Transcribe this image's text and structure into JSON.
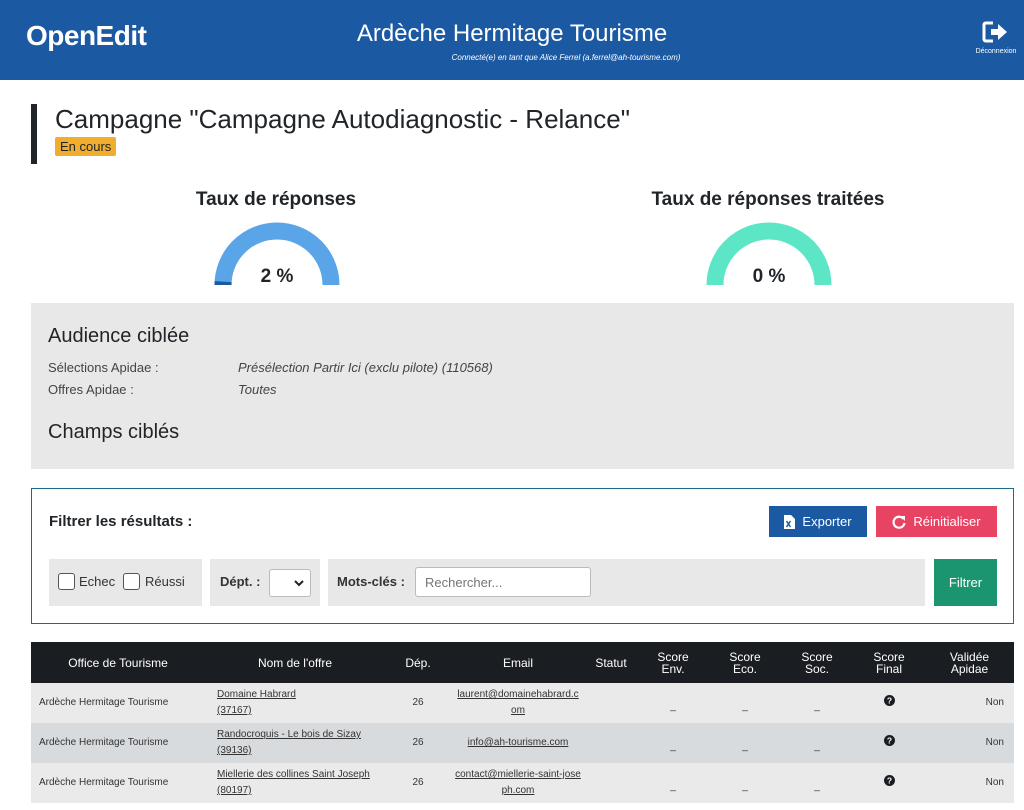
{
  "header": {
    "logo": "OpenEdit",
    "org_name": "Ardèche Hermitage Tourisme",
    "connected_as": "Connecté(e) en tant que Alice Ferrel (a.ferrel@ah-tourisme.com)",
    "logout_label": "Déconnexion"
  },
  "campaign": {
    "title": "Campagne \"Campagne Autodiagnostic - Relance\"",
    "status": "En cours",
    "status_color": "#f0ad2e"
  },
  "gauges": [
    {
      "title": "Taux de réponses",
      "value": 2,
      "value_label": "2 %",
      "color": "#5aa5e8",
      "fill_color": "#1b5aa3"
    },
    {
      "title": "Taux de réponses traitées",
      "value": 0,
      "value_label": "0 %",
      "color": "#5de6c6",
      "fill_color": "#1b9470"
    }
  ],
  "audience": {
    "heading": "Audience ciblée",
    "rows": [
      {
        "label": "Sélections Apidae :",
        "value": "Présélection Partir Ici (exclu pilote) (110568)"
      },
      {
        "label": "Offres Apidae :",
        "value": "Toutes"
      }
    ],
    "fields_heading": "Champs ciblés"
  },
  "filter": {
    "title": "Filtrer les résultats :",
    "export_label": "Exporter",
    "reset_label": "Réinitialiser",
    "checkbox_fail": "Echec",
    "checkbox_success": "Réussi",
    "dept_label": "Dépt. :",
    "dept_value": "",
    "keywords_label": "Mots-clés :",
    "search_placeholder": "Rechercher...",
    "search_value": "",
    "filter_button": "Filtrer"
  },
  "table": {
    "columns": [
      "Office de Tourisme",
      "Nom de l'offre",
      "Dép.",
      "Email",
      "Statut",
      "Score Env.",
      "Score Eco.",
      "Score Soc.",
      "Score Final",
      "Validée Apidae"
    ],
    "rows": [
      {
        "office": "Ardèche Hermitage Tourisme",
        "offer": "Domaine Habrard",
        "offer_id": "(37167)",
        "dept": "26",
        "email": "laurent@domainehabrard.com",
        "status": "",
        "env": "_",
        "eco": "_",
        "soc": "_",
        "validated": "Non"
      },
      {
        "office": "Ardèche Hermitage Tourisme",
        "offer": "Randocroquis - Le bois de Sizay",
        "offer_id": "(39136)",
        "dept": "26",
        "email": "info@ah-tourisme.com",
        "status": "",
        "env": "_",
        "eco": "_",
        "soc": "_",
        "validated": "Non"
      },
      {
        "office": "Ardèche Hermitage Tourisme",
        "offer": "Miellerie des collines Saint Joseph",
        "offer_id": "(80197)",
        "dept": "26",
        "email": "contact@miellerie-saint-joseph.com",
        "status": "",
        "env": "_",
        "eco": "_",
        "soc": "_",
        "validated": "Non"
      }
    ]
  }
}
